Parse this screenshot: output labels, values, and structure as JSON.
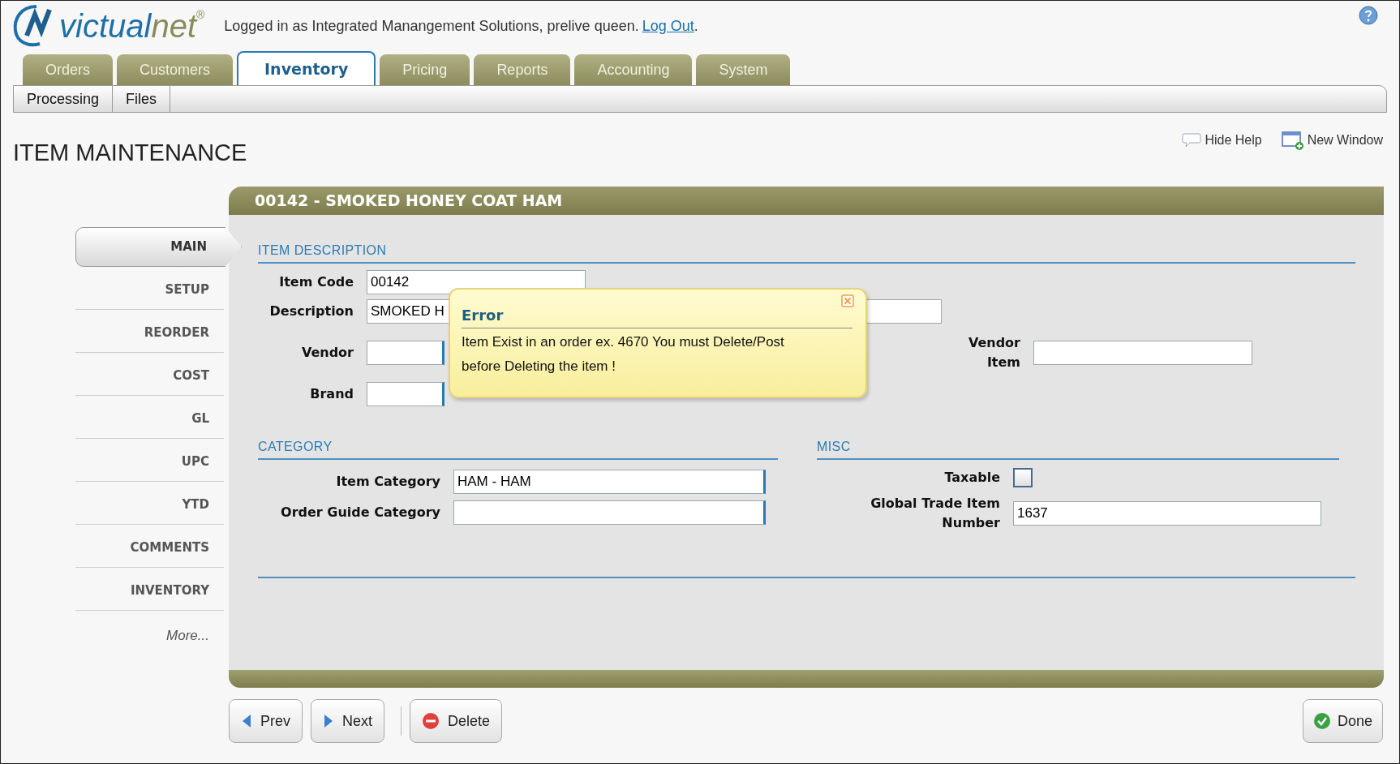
{
  "header": {
    "logo_first": "victual",
    "logo_second": "net",
    "logo_mark": "®",
    "login_text": "Logged in as Integrated Manangement Solutions, prelive queen.",
    "logout_link": "Log Out",
    "login_end": "."
  },
  "tabs": [
    {
      "label": "Orders",
      "selected": false
    },
    {
      "label": "Customers",
      "selected": false
    },
    {
      "label": "Inventory",
      "selected": true
    },
    {
      "label": "Pricing",
      "selected": false
    },
    {
      "label": "Reports",
      "selected": false
    },
    {
      "label": "Accounting",
      "selected": false
    },
    {
      "label": "System",
      "selected": false
    }
  ],
  "subtabs": [
    "Processing",
    "Files"
  ],
  "page_title": "ITEM MAINTENANCE",
  "help_links": [
    {
      "label": "Hide Help",
      "kind": "help"
    },
    {
      "label": "New Window",
      "kind": "window"
    }
  ],
  "side_nav": [
    {
      "label": "MAIN",
      "selected": true
    },
    {
      "label": "SETUP",
      "selected": false
    },
    {
      "label": "REORDER",
      "selected": false
    },
    {
      "label": "COST",
      "selected": false
    },
    {
      "label": "GL",
      "selected": false
    },
    {
      "label": "UPC",
      "selected": false
    },
    {
      "label": "YTD",
      "selected": false
    },
    {
      "label": "COMMENTS",
      "selected": false
    },
    {
      "label": "INVENTORY",
      "selected": false
    }
  ],
  "more_link": "More...",
  "record_title": "00142 - SMOKED HONEY COAT HAM",
  "item_description": {
    "title": "ITEM DESCRIPTION",
    "item_code": {
      "label": "Item Code",
      "value": "00142"
    },
    "description": {
      "label": "Description",
      "value": "SMOKED H"
    },
    "vendor": {
      "label": "Vendor"
    },
    "brand": {
      "label": "Brand"
    },
    "vendor_item": {
      "label": "Vendor Item"
    }
  },
  "category": {
    "title": "CATEGORY",
    "item_category": {
      "label": "Item Category",
      "value": "HAM - HAM"
    },
    "order_guide_category": {
      "label": "Order Guide Category"
    }
  },
  "misc": {
    "title": "MISC",
    "taxable": {
      "label": "Taxable",
      "checked": false
    },
    "gtin": {
      "label": "Global Trade Item Number",
      "value": "1637"
    }
  },
  "error": {
    "title": "Error",
    "message": "Item Exist in an order ex. 4670 You must Delete/Post before Deleting the item !"
  },
  "buttons": [
    {
      "label": "Prev",
      "kind": "prev"
    },
    {
      "label": "Next",
      "kind": "next"
    },
    {
      "label": "Delete",
      "kind": "delete"
    }
  ],
  "done_button": {
    "label": "Done"
  }
}
